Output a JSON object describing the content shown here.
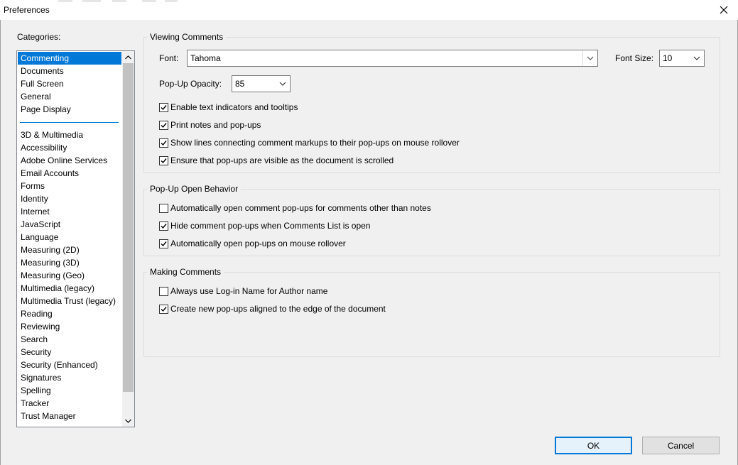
{
  "window": {
    "title": "Preferences"
  },
  "categories": {
    "label": "Categories:",
    "selected": "Commenting",
    "top_items": [
      "Commenting",
      "Documents",
      "Full Screen",
      "General",
      "Page Display"
    ],
    "items": [
      "3D & Multimedia",
      "Accessibility",
      "Adobe Online Services",
      "Email Accounts",
      "Forms",
      "Identity",
      "Internet",
      "JavaScript",
      "Language",
      "Measuring (2D)",
      "Measuring (3D)",
      "Measuring (Geo)",
      "Multimedia (legacy)",
      "Multimedia Trust (legacy)",
      "Reading",
      "Reviewing",
      "Search",
      "Security",
      "Security (Enhanced)",
      "Signatures",
      "Spelling",
      "Tracker",
      "Trust Manager"
    ]
  },
  "viewing": {
    "title": "Viewing Comments",
    "font_label": "Font:",
    "font_value": "Tahoma",
    "font_size_label": "Font Size:",
    "font_size_value": "10",
    "opacity_label": "Pop-Up Opacity:",
    "opacity_value": "85",
    "checkboxes": [
      {
        "label": "Enable text indicators and tooltips",
        "checked": true
      },
      {
        "label": "Print notes and pop-ups",
        "checked": true
      },
      {
        "label": "Show lines connecting comment markups to their pop-ups on mouse rollover",
        "checked": true
      },
      {
        "label": "Ensure that pop-ups are visible as the document is scrolled",
        "checked": true
      }
    ]
  },
  "popup_behavior": {
    "title": "Pop-Up Open Behavior",
    "checkboxes": [
      {
        "label": "Automatically open comment pop-ups for comments other than notes",
        "checked": false
      },
      {
        "label": "Hide comment pop-ups when Comments List is open",
        "checked": true
      },
      {
        "label": "Automatically open pop-ups on mouse rollover",
        "checked": true
      }
    ]
  },
  "making": {
    "title": "Making Comments",
    "checkboxes": [
      {
        "label": "Always use Log-in Name for Author name",
        "checked": false
      },
      {
        "label": "Create new pop-ups aligned to the edge of the document",
        "checked": true
      }
    ]
  },
  "buttons": {
    "ok": "OK",
    "cancel": "Cancel"
  },
  "colors": {
    "selection": "#0078d7",
    "ok_border": "#0078d7"
  }
}
